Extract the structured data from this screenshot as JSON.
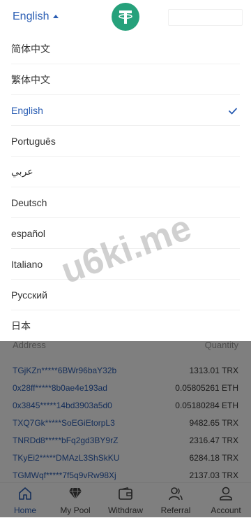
{
  "header": {
    "current_language": "English"
  },
  "language_menu": {
    "items": [
      {
        "label": "简体中文"
      },
      {
        "label": "繁体中文"
      },
      {
        "label": "English"
      },
      {
        "label": "Português"
      },
      {
        "label": "عربي"
      },
      {
        "label": "Deutsch"
      },
      {
        "label": "español"
      },
      {
        "label": "Italiano"
      },
      {
        "label": "Русский"
      },
      {
        "label": "日本"
      }
    ],
    "selected": "English"
  },
  "list": {
    "address_header": "Address",
    "quantity_header": "Quantity",
    "rows": [
      {
        "address": "TGjKZn*****6BWr96baY32b",
        "quantity": "1313.01 TRX"
      },
      {
        "address": "0x28ff*****8b0ae4e193ad",
        "quantity": "0.05805261 ETH"
      },
      {
        "address": "0x3845*****14bd3903a5d0",
        "quantity": "0.05180284 ETH"
      },
      {
        "address": "TXQ7Gk*****SoEGiEtorpL3",
        "quantity": "9482.65 TRX"
      },
      {
        "address": "TNRDd8*****bFq2gd3BY9rZ",
        "quantity": "2316.47 TRX"
      },
      {
        "address": "TKyEi2*****DMAzL3ShSkKU",
        "quantity": "6284.18 TRX"
      },
      {
        "address": "TGMWqf*****7f5q9vRw98Xj",
        "quantity": "2137.03 TRX"
      }
    ]
  },
  "tabbar": {
    "tabs": [
      {
        "label": "Home",
        "icon": "home-icon"
      },
      {
        "label": "My Pool",
        "icon": "diamond-icon"
      },
      {
        "label": "Withdraw",
        "icon": "wallet-icon"
      },
      {
        "label": "Referral",
        "icon": "users-icon"
      },
      {
        "label": "Account",
        "icon": "user-icon"
      }
    ],
    "active": "Home"
  },
  "watermark": "u6ki.me",
  "colors": {
    "accent": "#2a5db3",
    "brand": "#26a17b",
    "overlay": "rgba(0,0,0,0.5)"
  }
}
